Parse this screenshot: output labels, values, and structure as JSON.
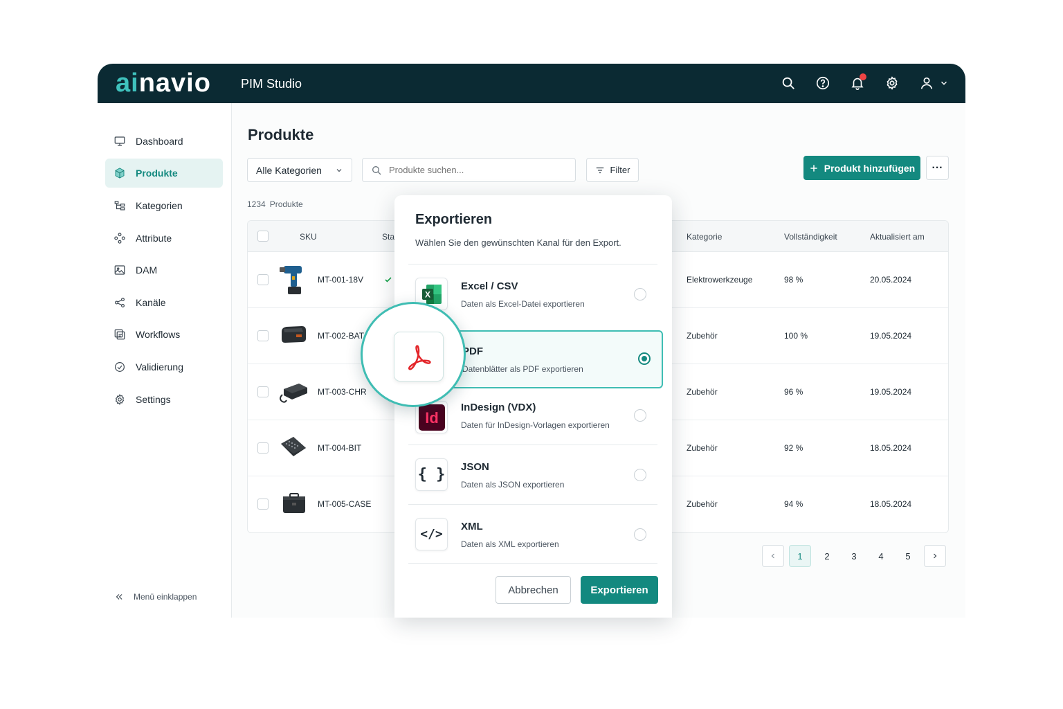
{
  "topbar": {
    "logo_ai": "ai",
    "logo_rest": "navio",
    "app_name": "PIM Studio"
  },
  "sidebar": {
    "items": [
      {
        "label": "Dashboard",
        "icon": "monitor-icon"
      },
      {
        "label": "Produkte",
        "icon": "cube-icon",
        "active": true
      },
      {
        "label": "Kategorien",
        "icon": "hierarchy-icon"
      },
      {
        "label": "Attribute",
        "icon": "nodes-icon"
      },
      {
        "label": "DAM",
        "icon": "image-icon"
      },
      {
        "label": "Kanäle",
        "icon": "share-icon"
      },
      {
        "label": "Workflows",
        "icon": "workflow-icon"
      },
      {
        "label": "Validierung",
        "icon": "check-circle-icon"
      },
      {
        "label": "Settings",
        "icon": "gear-icon"
      }
    ],
    "collapse_label": "Menü einklappen"
  },
  "main": {
    "title": "Produkte",
    "category_select": "Alle Kategorien",
    "search_placeholder": "Produkte suchen...",
    "filter_label": "Filter",
    "add_label": "Produkt hinzufügen",
    "more_label": "···",
    "count_number": "1234",
    "count_label": "Produkte"
  },
  "table": {
    "headers": {
      "sku": "SKU",
      "status": "Sta",
      "category": "Kategorie",
      "completeness": "Vollständigkeit",
      "updated": "Aktualisiert am"
    },
    "rows": [
      {
        "sku": "MT-001-18V",
        "category": "Elektrowerkzeuge",
        "completeness": "98 %",
        "updated": "20.05.2024",
        "image": "drill"
      },
      {
        "sku": "MT-002-BAT",
        "category": "Zubehör",
        "completeness": "100 %",
        "updated": "19.05.2024",
        "image": "battery"
      },
      {
        "sku": "MT-003-CHR",
        "category": "Zubehör",
        "completeness": "96 %",
        "updated": "19.05.2024",
        "image": "charger"
      },
      {
        "sku": "MT-004-BIT",
        "category": "Zubehör",
        "completeness": "92 %",
        "updated": "18.05.2024",
        "image": "bit-set"
      },
      {
        "sku": "MT-005-CASE",
        "category": "Zubehör",
        "completeness": "94 %",
        "updated": "18.05.2024",
        "image": "case"
      }
    ]
  },
  "pagination": {
    "pages": [
      "1",
      "2",
      "3",
      "4",
      "5"
    ],
    "active": "1"
  },
  "modal": {
    "title": "Exportieren",
    "subtitle": "Wählen Sie den gewünschten Kanal für den Export.",
    "options": [
      {
        "title": "Excel / CSV",
        "desc": "Daten als Excel-Datei exportieren",
        "icon": "excel-icon"
      },
      {
        "title": "PDF",
        "desc": "Datenblätter als PDF exportieren",
        "icon": "pdf-icon",
        "selected": true
      },
      {
        "title": "InDesign (VDX)",
        "desc": "Daten für InDesign-Vorlagen exportieren",
        "icon": "indesign-icon",
        "icon_text": "Id"
      },
      {
        "title": "JSON",
        "desc": "Daten als JSON exportieren",
        "icon": "json-braces-icon",
        "icon_text": "{ }"
      },
      {
        "title": "XML",
        "desc": "Daten als XML exportieren",
        "icon": "xml-code-icon",
        "icon_text": "</>"
      }
    ],
    "excel_icon_text": "X",
    "cancel_label": "Abbrechen",
    "export_label": "Exportieren"
  },
  "colors": {
    "topbar": "#0b2a33",
    "accent": "#13897f",
    "accent_light": "#3fbdb3",
    "notification": "#ef4444",
    "excel": "#1f7a45",
    "pdf": "#e3262b",
    "indesign": "#e0195a"
  }
}
